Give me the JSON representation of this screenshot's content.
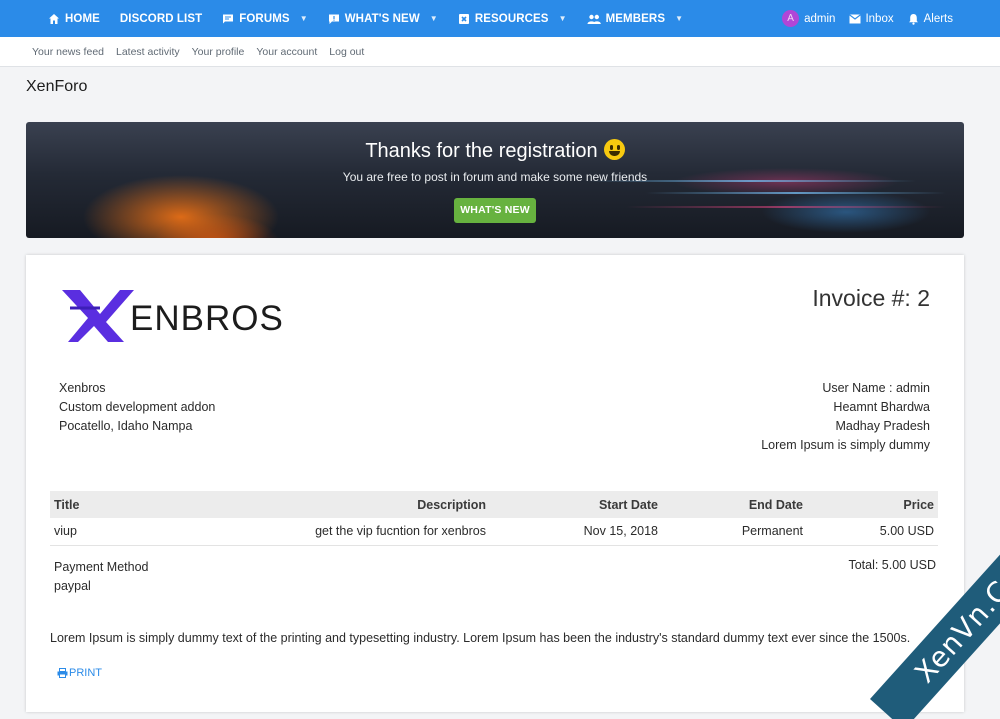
{
  "nav": {
    "tabs": [
      {
        "label": "HOME",
        "icon": "home-icon",
        "dropdown": false
      },
      {
        "label": "DISCORD LIST",
        "icon": "",
        "dropdown": false
      },
      {
        "label": "FORUMS",
        "icon": "forum-icon",
        "dropdown": true
      },
      {
        "label": "WHAT'S NEW",
        "icon": "speech-bubble-icon",
        "dropdown": true
      },
      {
        "label": "RESOURCES",
        "icon": "resources-icon",
        "dropdown": true
      },
      {
        "label": "MEMBERS",
        "icon": "members-icon",
        "dropdown": true
      }
    ],
    "user": {
      "avatar_letter": "A",
      "name": "admin"
    },
    "inbox_label": "Inbox",
    "alerts_label": "Alerts",
    "accent_color": "#2b8be8"
  },
  "subnav": [
    "Your news feed",
    "Latest activity",
    "Your profile",
    "Your account",
    "Log out"
  ],
  "page_title": "XenForo",
  "banner": {
    "title": "Thanks for the registration",
    "subtitle": "You are free to post in forum and make some new friends",
    "button": "WHAT'S NEW",
    "button_color": "#67b23f"
  },
  "invoice": {
    "logo_text": "ENBROS",
    "logo_color": "#5a2ee0",
    "number": "Invoice #: 2",
    "from": [
      "Xenbros",
      "Custom development addon",
      "Pocatello, Idaho Nampa"
    ],
    "to": [
      "User Name : admin",
      "Heamnt Bhardwa",
      "Madhay Pradesh",
      "Lorem Ipsum is simply dummy"
    ],
    "columns": {
      "title": "Title",
      "description": "Description",
      "start": "Start Date",
      "end": "End Date",
      "price": "Price"
    },
    "rows": [
      {
        "title": "viup",
        "description": "get the vip fucntion for xenbros",
        "start": "Nov 15, 2018",
        "end": "Permanent",
        "price": "5.00 USD"
      }
    ],
    "payment_label": "Payment Method",
    "payment_value": "paypal",
    "total": "Total: 5.00 USD",
    "notes": "Lorem Ipsum is simply dummy text of the printing and typesetting industry. Lorem Ipsum has been the industry's standard dummy text ever since the 1500s.",
    "print_label": "PRINT"
  },
  "watermark": "XenVn.Com"
}
